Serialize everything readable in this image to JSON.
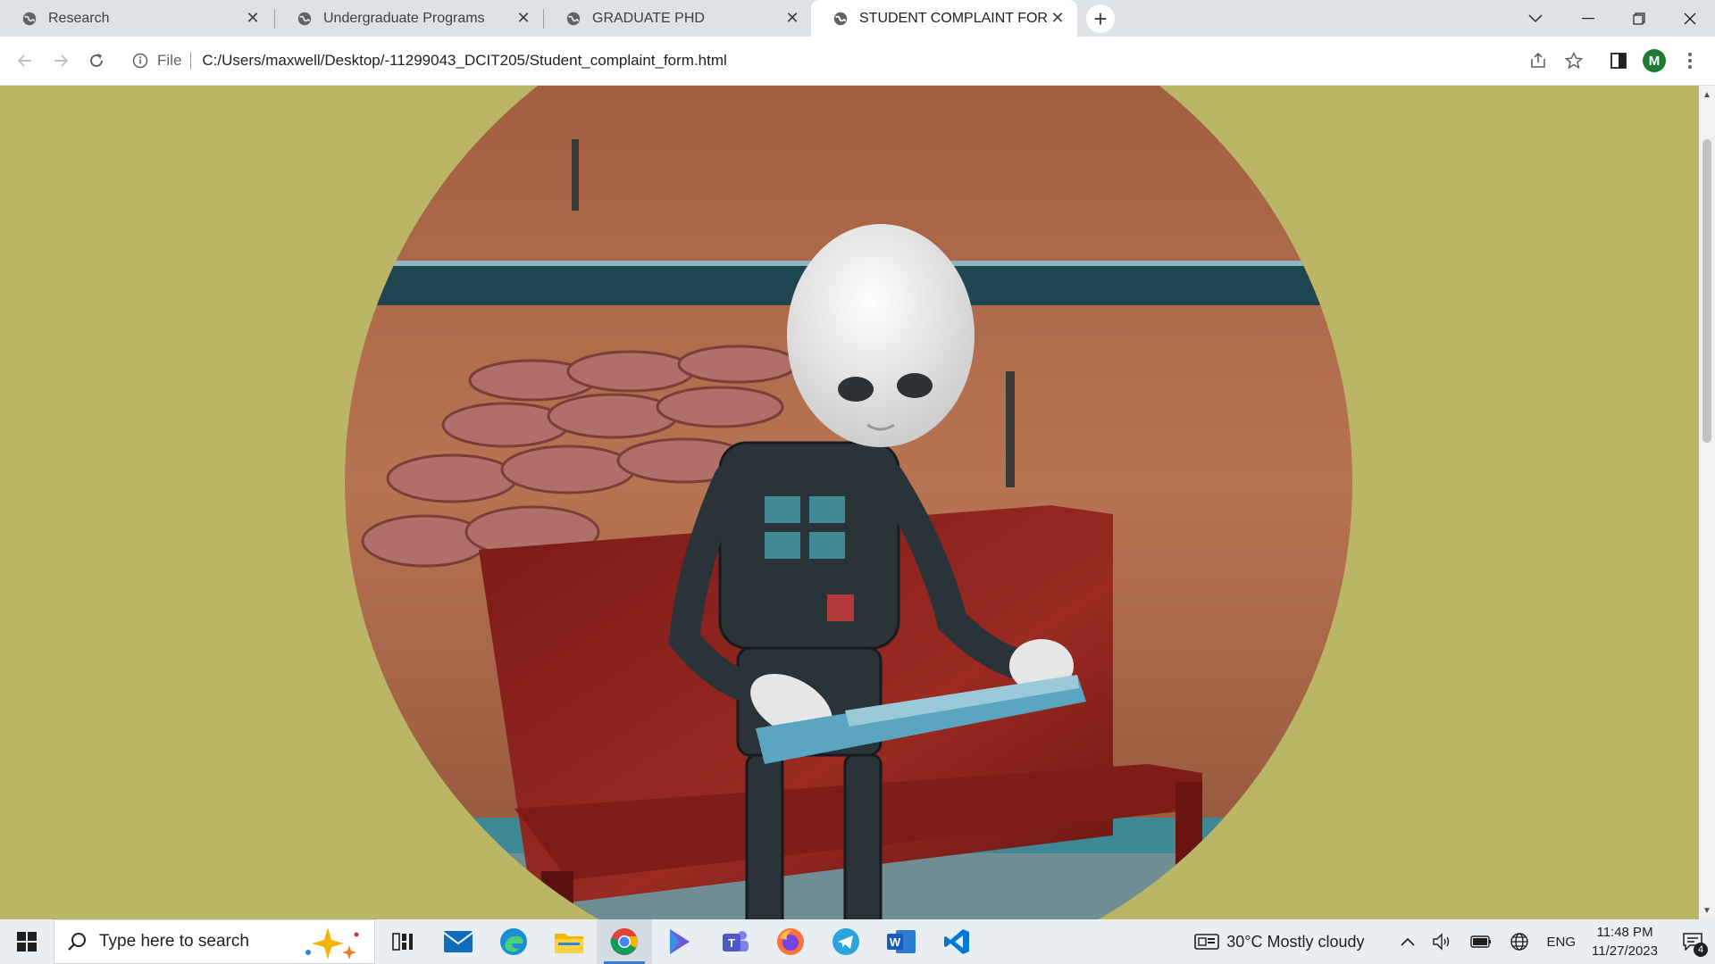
{
  "browser": {
    "tabs": [
      {
        "title": "Research",
        "active": false
      },
      {
        "title": "Undergraduate Programs",
        "active": false
      },
      {
        "title": "GRADUATE PHD",
        "active": false
      },
      {
        "title": "STUDENT COMPLAINT FORM",
        "active": true
      }
    ],
    "new_tab_symbol": "+",
    "address": {
      "scheme_label": "File",
      "url": "C:/Users/maxwell/Desktop/-11299043_DCIT205/Student_complaint_form.html"
    },
    "profile_initial": "M"
  },
  "page": {
    "background_color": "#bbb666",
    "hero_image": "robot-reading-on-bench-circle-photo"
  },
  "taskbar": {
    "search_placeholder": "Type here to search",
    "apps": [
      "task-view",
      "mail",
      "edge",
      "file-explorer",
      "chrome",
      "copilot",
      "teams",
      "firefox",
      "telegram",
      "word",
      "vscode"
    ],
    "active_app": "chrome",
    "weather": {
      "temp": "30°C",
      "condition": "Mostly cloudy"
    },
    "language": "ENG",
    "time": "11:48 PM",
    "date": "11/27/2023",
    "notification_count": "4"
  }
}
